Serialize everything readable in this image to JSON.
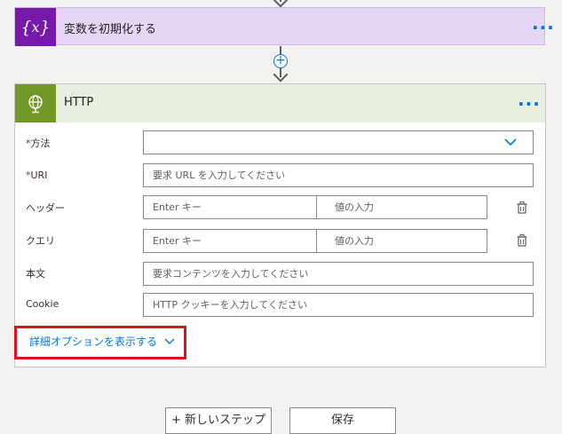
{
  "variable_card": {
    "title": "変数を初期化する",
    "icon": "variable-icon",
    "more_label": "···"
  },
  "http_card": {
    "title": "HTTP",
    "icon": "globe-icon",
    "more_label": "···",
    "fields": {
      "method": {
        "label": "方法",
        "required_mark": "*",
        "value": ""
      },
      "uri": {
        "label": "URI",
        "required_mark": "*",
        "placeholder": "要求 URL を入力してください"
      },
      "headers": {
        "label": "ヘッダー",
        "key_placeholder": "Enter キー",
        "value_placeholder": "値の入力"
      },
      "queries": {
        "label": "クエリ",
        "key_placeholder": "Enter キー",
        "value_placeholder": "値の入力"
      },
      "body": {
        "label": "本文",
        "placeholder": "要求コンテンツを入力してください"
      },
      "cookie": {
        "label": "Cookie",
        "placeholder": "HTTP クッキーを入力してください"
      }
    },
    "advanced_options": "詳細オプションを表示する"
  },
  "footer": {
    "new_step": "+ 新しいステップ",
    "save": "保存"
  },
  "colors": {
    "accent": "#0078d4",
    "variable_header": "#e5d6f6",
    "variable_icon_bg": "#7719aa",
    "http_header": "#e8efe0",
    "http_icon_bg": "#709727",
    "highlight": "#e0101d"
  }
}
